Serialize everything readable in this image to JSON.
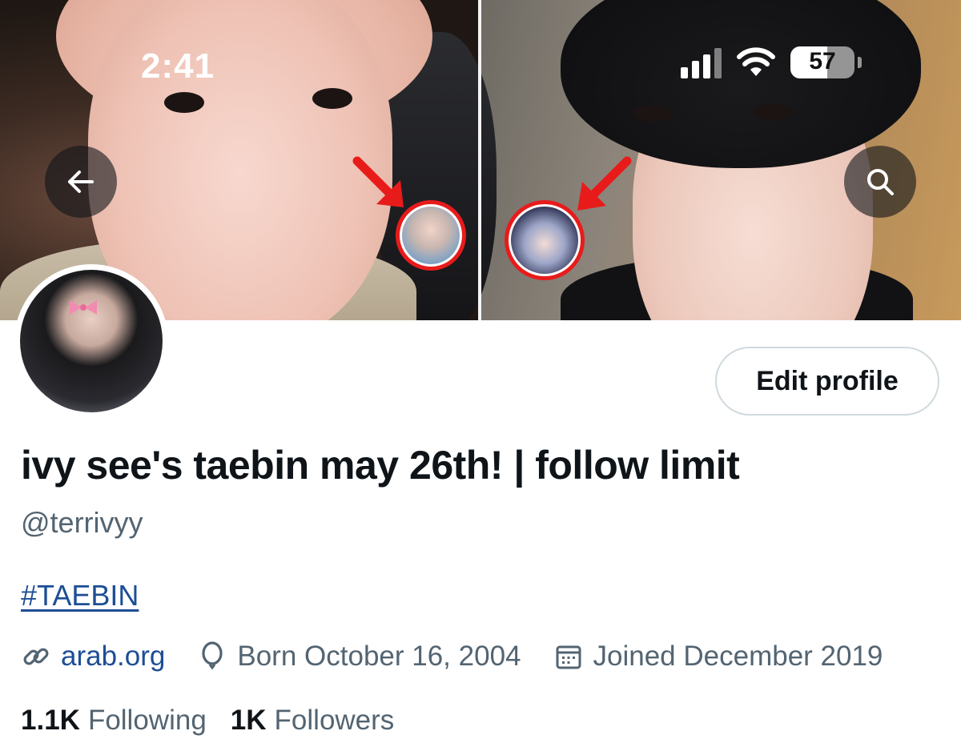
{
  "status_bar": {
    "time": "2:41",
    "battery_percent": "57",
    "battery_level": 0.57
  },
  "header": {
    "back_icon": "arrow-left-icon",
    "search_icon": "search-icon"
  },
  "profile": {
    "edit_button_label": "Edit profile",
    "display_name": "ivy see's taebin may 26th! | follow limit",
    "handle": "@terrivyy",
    "bio_hashtag": "#TAEBIN",
    "website": "arab.org",
    "birth": "Born October 16, 2004",
    "joined": "Joined December 2019",
    "following_count": "1.1K",
    "following_label": "Following",
    "followers_count": "1K",
    "followers_label": "Followers"
  },
  "colors": {
    "link": "#1d4e95",
    "secondary_text": "#536471",
    "highlight_ring": "#e81b1b"
  }
}
